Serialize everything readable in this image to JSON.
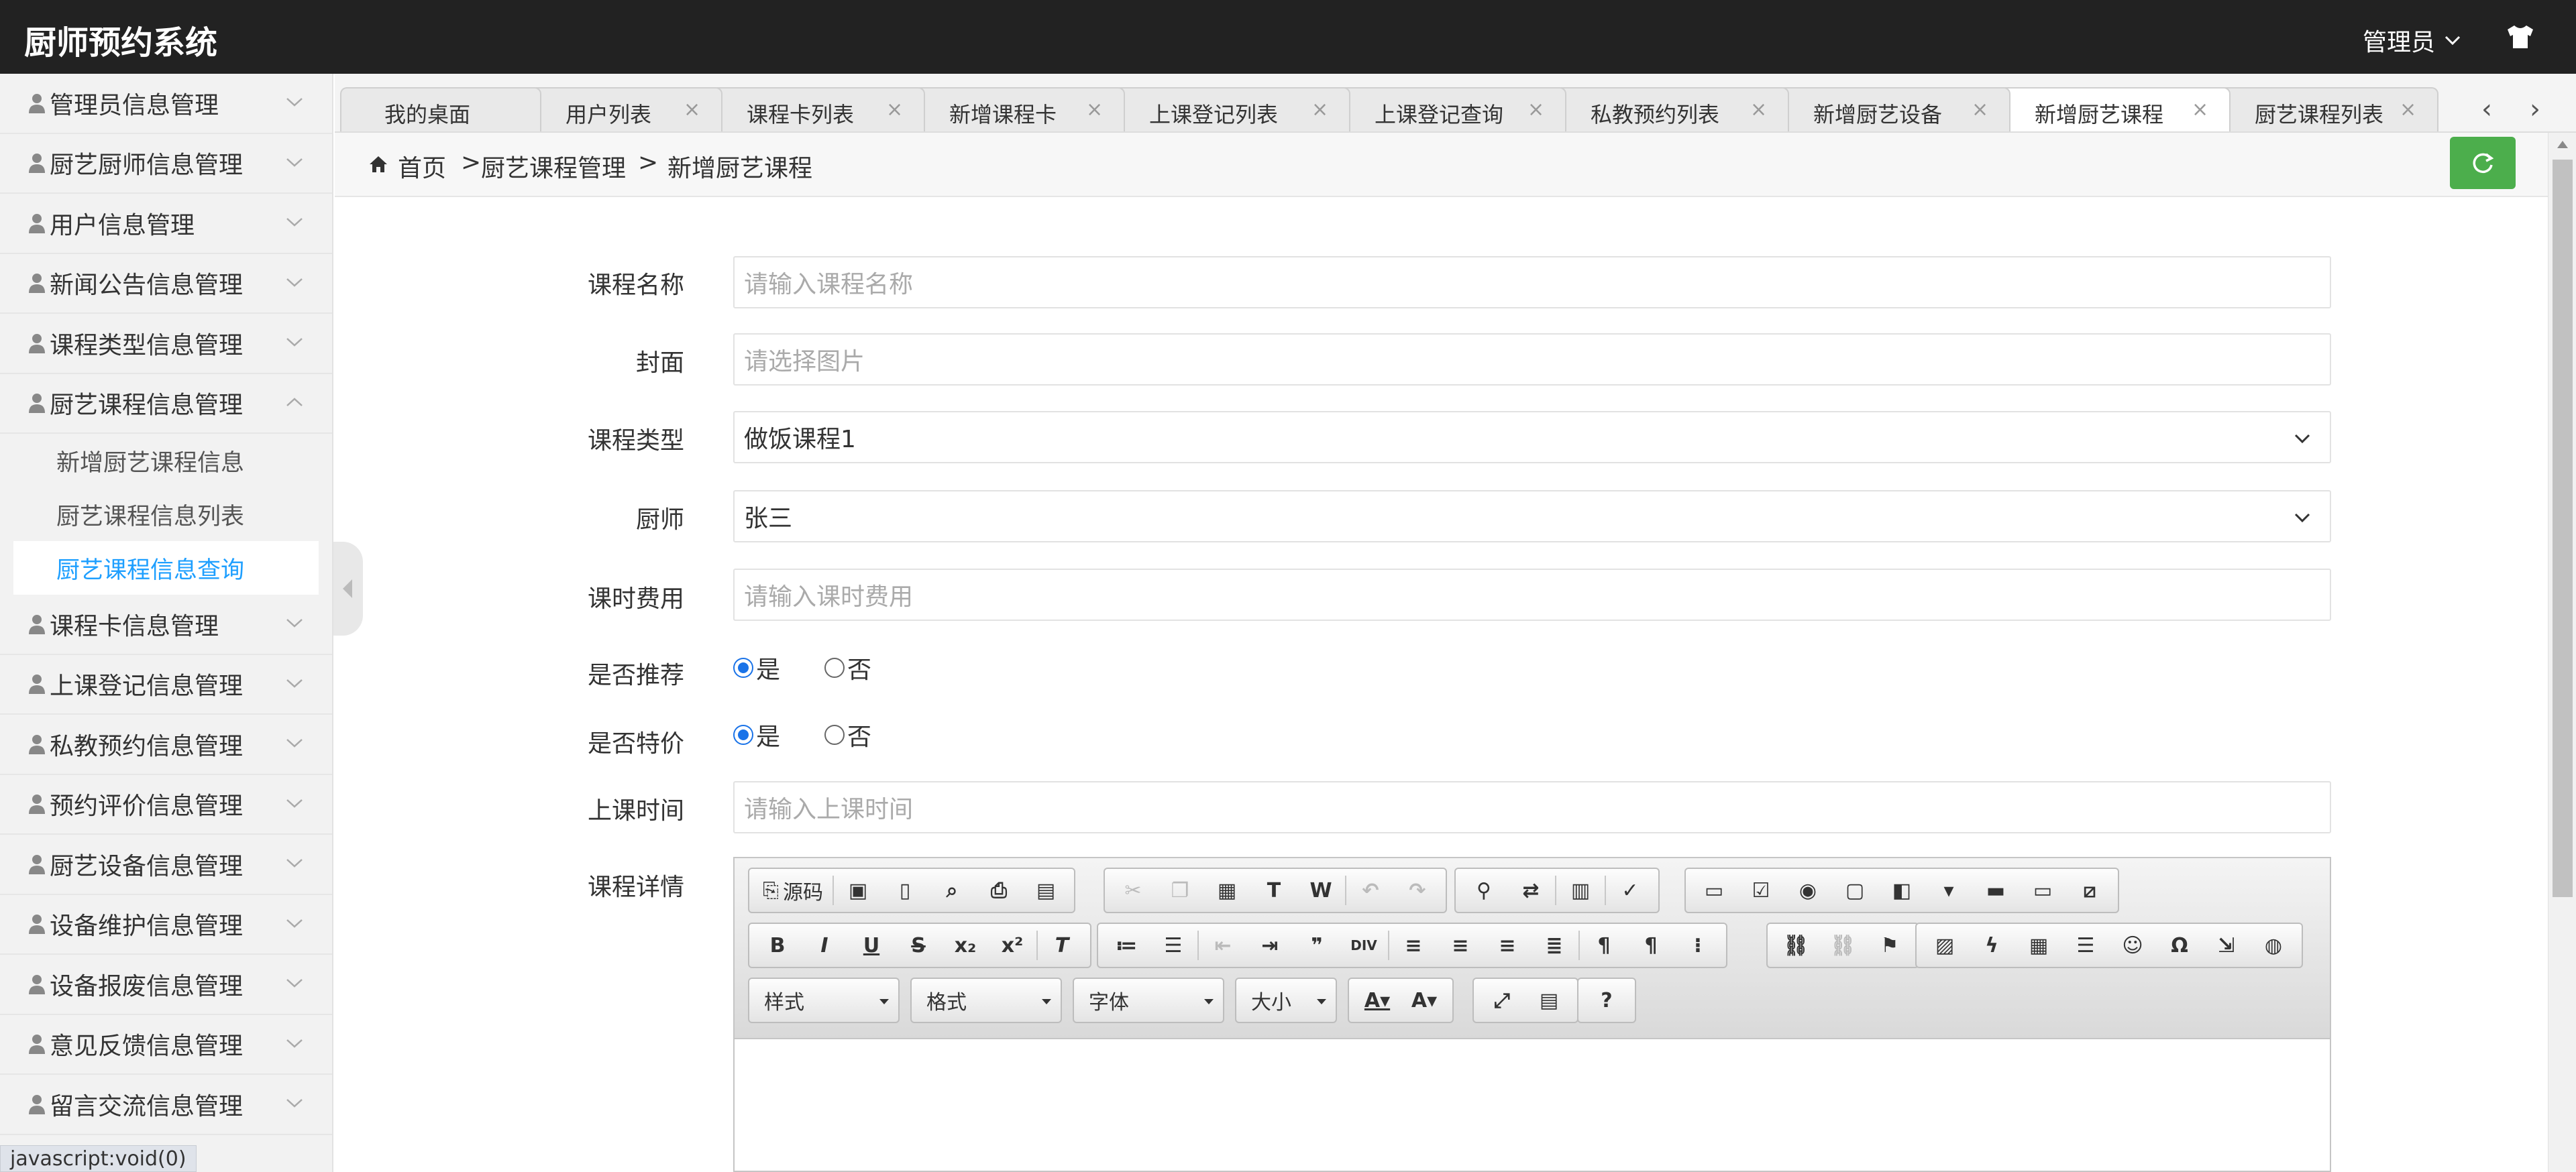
{
  "app": {
    "title": "厨师预约系统",
    "user": "管理员"
  },
  "sidebar": {
    "items": [
      {
        "label": "管理员信息管理",
        "expanded": false
      },
      {
        "label": "厨艺厨师信息管理",
        "expanded": false
      },
      {
        "label": "用户信息管理",
        "expanded": false
      },
      {
        "label": "新闻公告信息管理",
        "expanded": false
      },
      {
        "label": "课程类型信息管理",
        "expanded": false
      },
      {
        "label": "厨艺课程信息管理",
        "expanded": true,
        "children": [
          "新增厨艺课程信息",
          "厨艺课程信息列表",
          "厨艺课程信息查询"
        ],
        "active_child": 2
      },
      {
        "label": "课程卡信息管理",
        "expanded": false
      },
      {
        "label": "上课登记信息管理",
        "expanded": false
      },
      {
        "label": "私教预约信息管理",
        "expanded": false
      },
      {
        "label": "预约评价信息管理",
        "expanded": false
      },
      {
        "label": "厨艺设备信息管理",
        "expanded": false
      },
      {
        "label": "设备维护信息管理",
        "expanded": false
      },
      {
        "label": "设备报废信息管理",
        "expanded": false
      },
      {
        "label": "意见反馈信息管理",
        "expanded": false
      },
      {
        "label": "留言交流信息管理",
        "expanded": false
      }
    ]
  },
  "status_bar": "javascript:void(0)",
  "tabs": [
    {
      "label": "我的桌面",
      "closable": false
    },
    {
      "label": "用户列表",
      "closable": true
    },
    {
      "label": "课程卡列表",
      "closable": true
    },
    {
      "label": "新增课程卡",
      "closable": true
    },
    {
      "label": "上课登记列表",
      "closable": true
    },
    {
      "label": "上课登记查询",
      "closable": true
    },
    {
      "label": "私教预约列表",
      "closable": true
    },
    {
      "label": "新增厨艺设备",
      "closable": true
    },
    {
      "label": "新增厨艺课程",
      "closable": true,
      "active": true
    },
    {
      "label": "厨艺课程列表",
      "closable": true
    }
  ],
  "breadcrumb": {
    "home": "首页",
    "sep": ">",
    "level1": "厨艺课程管理",
    "level2": "新增厨艺课程"
  },
  "form": {
    "course_name": {
      "label": "课程名称",
      "placeholder": "请输入课程名称"
    },
    "cover": {
      "label": "封面",
      "placeholder": "请选择图片"
    },
    "course_type": {
      "label": "课程类型",
      "value": "做饭课程1"
    },
    "chef": {
      "label": "厨师",
      "value": "张三"
    },
    "fee": {
      "label": "课时费用",
      "placeholder": "请输入课时费用"
    },
    "recommend": {
      "label": "是否推荐",
      "options": [
        "是",
        "否"
      ],
      "selected": "是"
    },
    "special": {
      "label": "是否特价",
      "options": [
        "是",
        "否"
      ],
      "selected": "是"
    },
    "class_time": {
      "label": "上课时间",
      "placeholder": "请输入上课时间"
    },
    "details": {
      "label": "课程详情"
    }
  },
  "editor": {
    "source_label": "源码",
    "combos": [
      "样式",
      "格式",
      "字体",
      "大小"
    ]
  },
  "colors": {
    "topbar": "#222222",
    "active_link": "#1e9fff",
    "refresh": "#4cae4c",
    "radio": "#1a73e8"
  }
}
